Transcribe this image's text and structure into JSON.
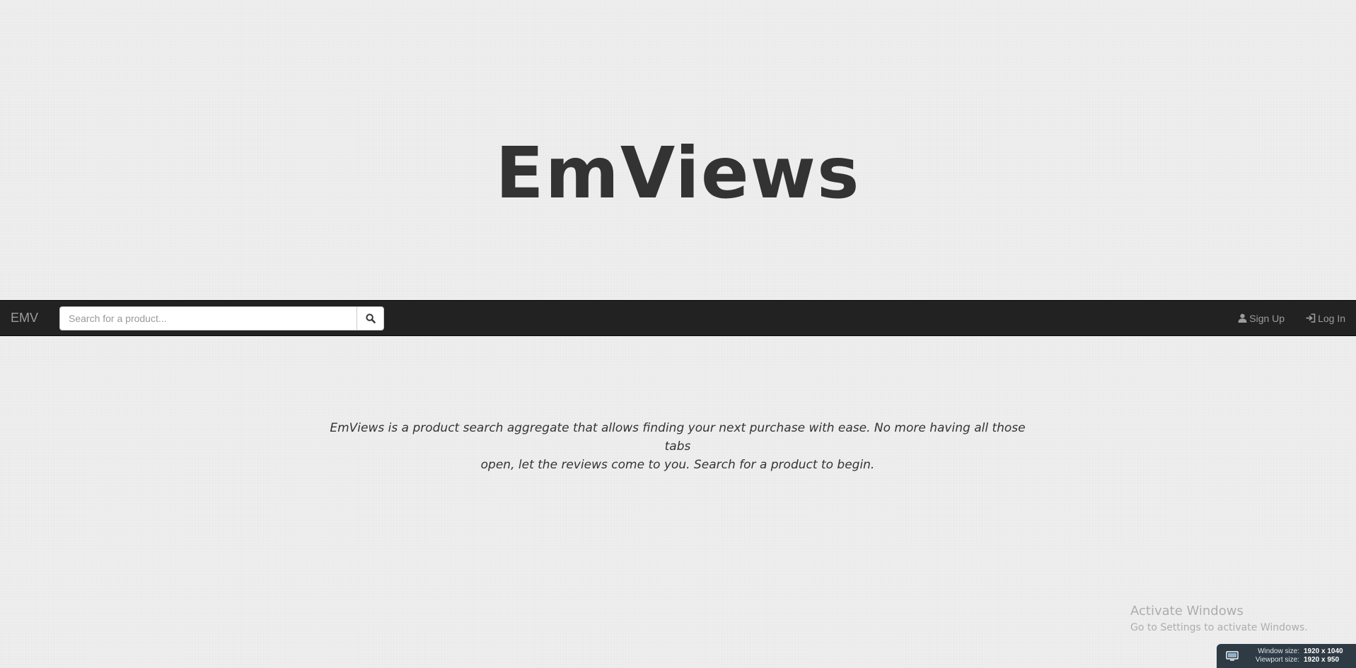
{
  "hero": {
    "title": "EmViews"
  },
  "navbar": {
    "brand": "EMV",
    "search": {
      "placeholder": "Search for a product...",
      "value": "",
      "button_icon": "search-icon"
    },
    "links": [
      {
        "label": "Sign Up",
        "icon": "user-icon"
      },
      {
        "label": "Log In",
        "icon": "log-in-icon"
      }
    ],
    "colors": {
      "background": "#222222",
      "link": "#9d9d9d"
    }
  },
  "main": {
    "tagline_line1": "EmViews is a product search aggregate that allows finding your next purchase with ease. No more having all those tabs",
    "tagline_line2": "open, let the reviews come to you. Search for a product to begin."
  },
  "watermark": {
    "title": "Activate Windows",
    "subtitle": "Go to Settings to activate Windows."
  },
  "size_badge": {
    "icon": "monitor-icon",
    "window_label": "Window size:",
    "window_value": "1920 x 1040",
    "viewport_label": "Viewport size:",
    "viewport_value": "1920 x 950"
  }
}
